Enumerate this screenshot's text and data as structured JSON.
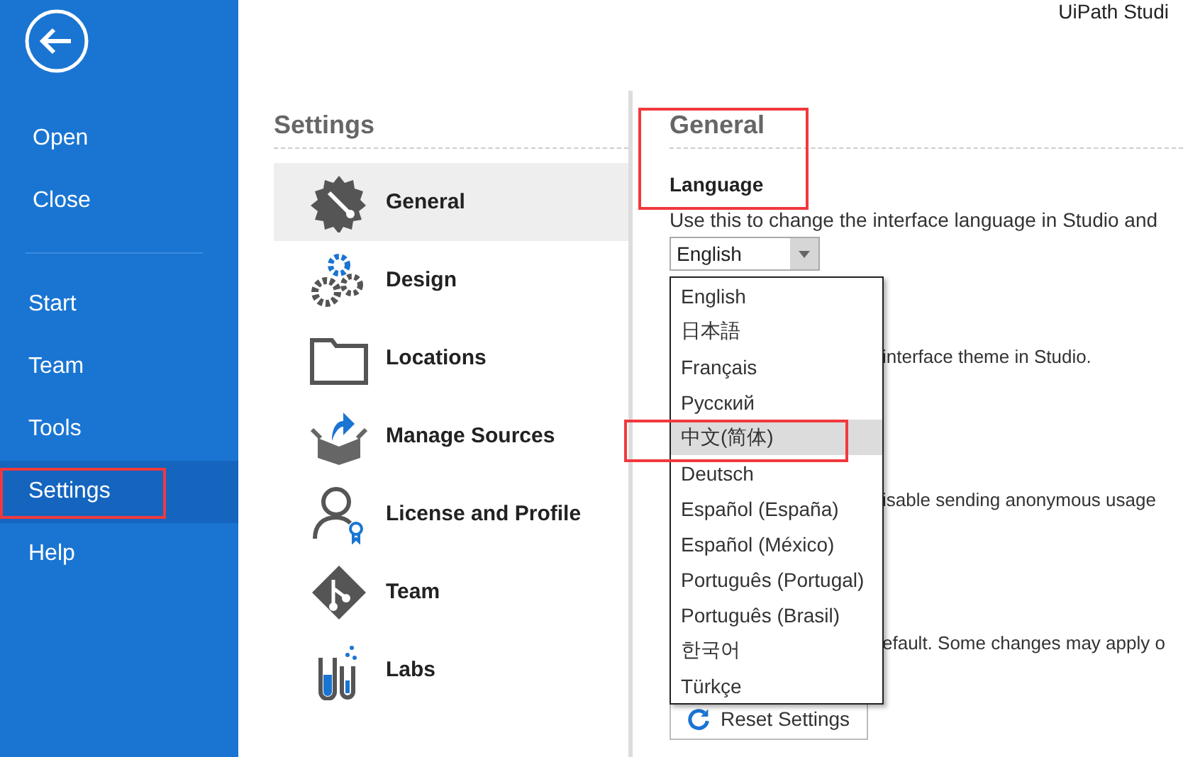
{
  "app_title": "UiPath Studi",
  "backstage": {
    "groups": [
      [
        {
          "label": "Open",
          "selected": false
        },
        {
          "label": "Close",
          "selected": false
        }
      ],
      [
        {
          "label": "Start",
          "selected": false
        },
        {
          "label": "Team",
          "selected": false
        },
        {
          "label": "Tools",
          "selected": false
        },
        {
          "label": "Settings",
          "selected": true
        },
        {
          "label": "Help",
          "selected": false
        }
      ]
    ]
  },
  "settings": {
    "title": "Settings",
    "items": [
      {
        "label": "General",
        "selected": true
      },
      {
        "label": "Design",
        "selected": false
      },
      {
        "label": "Locations",
        "selected": false
      },
      {
        "label": "Manage Sources",
        "selected": false
      },
      {
        "label": "License and Profile",
        "selected": false
      },
      {
        "label": "Team",
        "selected": false
      },
      {
        "label": "Labs",
        "selected": false
      }
    ]
  },
  "content": {
    "title": "General",
    "section": "Language",
    "description": "Use this to change the interface language in Studio and",
    "language_select": {
      "value": "English",
      "expanded": true,
      "options": [
        {
          "label": "English",
          "highlighted": false
        },
        {
          "label": "日本語",
          "highlighted": false
        },
        {
          "label": "Français",
          "highlighted": false
        },
        {
          "label": "Русский",
          "highlighted": false
        },
        {
          "label": "中文(简体)",
          "highlighted": true
        },
        {
          "label": "Deutsch",
          "highlighted": false
        },
        {
          "label": "Español (España)",
          "highlighted": false
        },
        {
          "label": "Español (México)",
          "highlighted": false
        },
        {
          "label": "Português (Portugal)",
          "highlighted": false
        },
        {
          "label": "Português (Brasil)",
          "highlighted": false
        },
        {
          "label": "한국어",
          "highlighted": false
        },
        {
          "label": "Türkçe",
          "highlighted": false
        }
      ]
    },
    "partial_lines": [
      "interface theme in Studio.",
      "isable sending anonymous usage",
      "efault. Some changes may apply o"
    ],
    "reset_button": "Reset Settings"
  }
}
